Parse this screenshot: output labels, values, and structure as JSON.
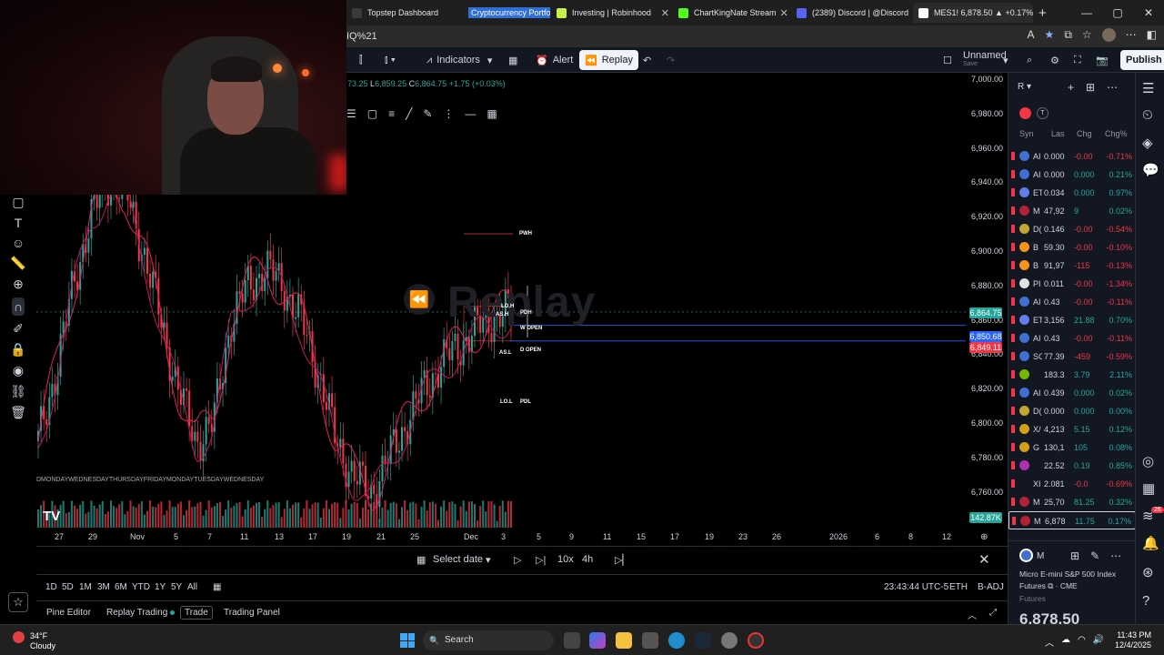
{
  "browser": {
    "tabs": [
      {
        "label": "Topstep Dashboard",
        "color": "#3a3a3a"
      },
      {
        "label": "Cryptocurrency Portfo",
        "color": "#2f6fd6"
      },
      {
        "label": "Investing | Robinhood",
        "color": "#c7f04a"
      },
      {
        "label": "ChartKingNate Stream",
        "color": "#53fc18"
      },
      {
        "label": "(2389) Discord | @Discord",
        "color": "#5865f2"
      },
      {
        "label": "MES1! 6,878.50 ▲ +0.17%",
        "color": "#ffffff"
      }
    ],
    "url": "IQ%21",
    "new_tab": "+",
    "window_controls": [
      "—",
      "▢",
      "✕"
    ]
  },
  "toolbar": {
    "indicators": "Indicators",
    "alert": "Alert",
    "replay": "Replay",
    "layout_name": "Unnamed",
    "layout_sub": "Save",
    "publish": "Publish"
  },
  "chart": {
    "ohlc_partial": "73.25",
    "low_label": "L",
    "low": "6,859.25",
    "close_label": "C",
    "close": "6,864.75",
    "change": "+1.75 (+0.03%)",
    "watermark": "Replay",
    "price_axis": [
      "7,000.00",
      "6,980.00",
      "6,960.00",
      "6,940.00",
      "6,920.00",
      "6,900.00",
      "6,880.00",
      "6,860.00",
      "6,840.00",
      "6,820.00",
      "6,800.00",
      "6,780.00",
      "6,760.00"
    ],
    "badges": [
      {
        "text": "6,864.75",
        "color": "#26a69a"
      },
      {
        "text": "6,850.68",
        "color": "#2962ff"
      },
      {
        "text": "6,849.11",
        "color": "#f23645"
      },
      {
        "text": "142.87K",
        "color": "#26a69a"
      }
    ],
    "levels": [
      "PWH",
      "LO.H",
      "AS.H",
      "W OPEN",
      "D OPEN",
      "AS.L",
      "LO.L",
      "PDL",
      "PDH"
    ],
    "time_axis": [
      "27",
      "29",
      "Nov",
      "5",
      "7",
      "11",
      "13",
      "17",
      "19",
      "21",
      "25",
      "Dec",
      "3",
      "5",
      "9",
      "11",
      "15",
      "17",
      "19",
      "23",
      "26",
      "2026",
      "6",
      "8",
      "12"
    ],
    "day_labels": "DMONDAYWEDNESDAYTHURSDAYFRIDAYMONDAYTUESDAYWEDNESDAY"
  },
  "chart_data": {
    "type": "line",
    "title": "",
    "xlabel": "",
    "ylabel": "",
    "ylim": [
      6760,
      7000
    ],
    "series": [
      {
        "values": [
          6790,
          6830,
          6880,
          6920,
          6940,
          6935,
          6900,
          6860,
          6820,
          6790,
          6800,
          6860,
          6880,
          6890,
          6880,
          6860,
          6830,
          6790,
          6770,
          6760,
          6780,
          6800,
          6820,
          6835,
          6845,
          6855,
          6862,
          6864.75
        ]
      }
    ]
  },
  "replay_bar": {
    "select_date": "Select date",
    "speed": "10x",
    "interval": "4h"
  },
  "timeframes": [
    "1D",
    "5D",
    "1M",
    "3M",
    "6M",
    "YTD",
    "1Y",
    "5Y",
    "All"
  ],
  "status": {
    "time": "23:43:44 UTC-5",
    "session": "ETH",
    "adj": "B-ADJ"
  },
  "panel_tabs": [
    "Pine Editor",
    "Replay Trading",
    "Trade",
    "Trading Panel"
  ],
  "watchlist": {
    "title": "R",
    "columns": [
      "Syn",
      "Las",
      "Chg",
      "Chg%"
    ],
    "rows": [
      {
        "sym": "AI",
        "last": "0.000",
        "chg": "-0.00",
        "pct": "-0.71%",
        "icon": "#3f6fd0",
        "up": false
      },
      {
        "sym": "AI",
        "last": "0.000",
        "chg": "0.000",
        "pct": "0.21%",
        "icon": "#3f6fd0",
        "up": true
      },
      {
        "sym": "ET",
        "last": "0.034",
        "chg": "0.000",
        "pct": "0.97%",
        "icon": "#627eea",
        "up": true
      },
      {
        "sym": "M",
        "last": "47,92",
        "chg": "9",
        "pct": "0.02%",
        "icon": "#b22234",
        "up": true
      },
      {
        "sym": "D(",
        "last": "0.146",
        "chg": "-0.00",
        "pct": "-0.54%",
        "icon": "#c2a633",
        "up": false
      },
      {
        "sym": "B",
        "last": "59.30",
        "chg": "-0.00",
        "pct": "-0.10%",
        "icon": "#f7931a",
        "up": false
      },
      {
        "sym": "B",
        "last": "91,97",
        "chg": "-115",
        "pct": "-0.13%",
        "icon": "#f7931a",
        "up": false
      },
      {
        "sym": "PI",
        "last": "0.011",
        "chg": "-0.00",
        "pct": "-1.34%",
        "icon": "#e0e0e0",
        "up": false
      },
      {
        "sym": "AI",
        "last": "0.43",
        "chg": "-0.00",
        "pct": "-0.11%",
        "icon": "#3f6fd0",
        "up": false
      },
      {
        "sym": "ET",
        "last": "3,156",
        "chg": "21.88",
        "pct": "0.70%",
        "icon": "#627eea",
        "up": true
      },
      {
        "sym": "AI",
        "last": "0.43",
        "chg": "-0.00",
        "pct": "-0.11%",
        "icon": "#3f6fd0",
        "up": false
      },
      {
        "sym": "SC",
        "last": "77.39",
        "chg": "-459",
        "pct": "-0.59%",
        "icon": "#3f6fd0",
        "up": false
      },
      {
        "sym": "",
        "last": "183.3",
        "chg": "3.79",
        "pct": "2.11%",
        "icon": "#76b900",
        "up": true
      },
      {
        "sym": "AI",
        "last": "0.439",
        "chg": "0.000",
        "pct": "0.02%",
        "icon": "#3f6fd0",
        "up": true
      },
      {
        "sym": "D(",
        "last": "0.000",
        "chg": "0.000",
        "pct": "0.00%",
        "icon": "#c2a633",
        "up": true
      },
      {
        "sym": "X/",
        "last": "4,213",
        "chg": "5.15",
        "pct": "0.12%",
        "icon": "#d4a017",
        "up": true
      },
      {
        "sym": "G",
        "last": "130,1",
        "chg": "105",
        "pct": "0.08%",
        "icon": "#d4a017",
        "up": true
      },
      {
        "sym": "",
        "last": "22.52",
        "chg": "0.19",
        "pct": "0.85%",
        "icon": "#b030b0",
        "up": true
      },
      {
        "sym": "XI",
        "last": "2.081",
        "chg": "-0.0",
        "pct": "-0.69%",
        "icon": "#131722",
        "up": false
      },
      {
        "sym": "M",
        "last": "25,70",
        "chg": "81.25",
        "pct": "0.32%",
        "icon": "#b22234",
        "up": true
      },
      {
        "sym": "M",
        "last": "6,878",
        "chg": "11.75",
        "pct": "0.17%",
        "icon": "#b22234",
        "up": true
      }
    ],
    "detail": {
      "symbol": "M",
      "name": "Micro E-mini S&P 500 Index Futures",
      "exchange": "CME",
      "type": "Futures",
      "price": "6,878.50"
    }
  },
  "taskbar": {
    "temp": "34°F",
    "weather": "Cloudy",
    "search": "Search",
    "time": "11:43 PM",
    "date": "12/4/2025",
    "notif_badge": "26"
  },
  "colors": {
    "up": "#26a69a",
    "down": "#f23645",
    "ma": "#e91e63"
  }
}
